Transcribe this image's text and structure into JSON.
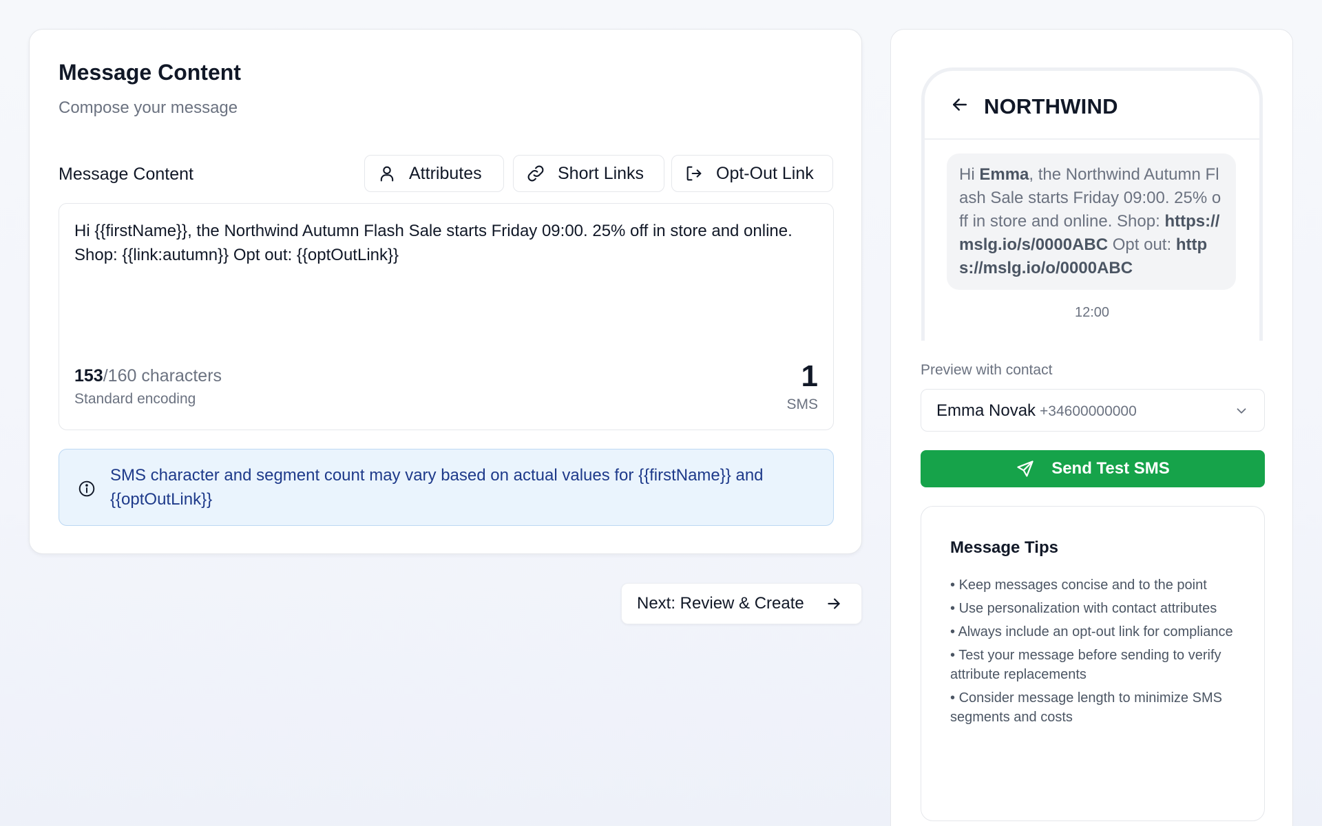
{
  "composer": {
    "title": "Message Content",
    "subtitle": "Compose your message",
    "field_label": "Message Content",
    "toolbar": {
      "attributes_label": "Attributes",
      "short_links_label": "Short Links",
      "opt_out_label": "Opt-Out Link"
    },
    "message_text": "Hi {{firstName}}, the Northwind Autumn Flash Sale starts Friday 09:00. 25% off in store and online. Shop: {{link:autumn}} Opt out: {{optOutLink}}",
    "char_count": "153",
    "char_limit": "/160 characters",
    "encoding": "Standard encoding",
    "sms_count": "1",
    "sms_unit": "SMS",
    "info_text": "SMS character and segment count may vary based on actual values for {{firstName}} and {{optOutLink}}"
  },
  "next_button_label": "Next: Review & Create",
  "preview": {
    "sender": "NORTHWIND",
    "bubble": {
      "part1": "Hi ",
      "name": "Emma",
      "part2": ", the Northwind Autumn Flash Sale starts Friday 09:00. 25% off in store and online. Shop: ",
      "link": "https://mslg.io/s/0000ABC",
      "part3": " Opt out: ",
      "optout_link": "https://mslg.io/o/0000ABC"
    },
    "time": "12:00",
    "contact_label": "Preview with contact",
    "contact_name": "Emma Novak",
    "contact_phone": "+34600000000",
    "send_button_label": "Send Test SMS"
  },
  "tips": {
    "title": "Message Tips",
    "items": [
      "Keep messages concise and to the point",
      "Use personalization with contact attributes",
      "Always include an opt-out link for compliance",
      "Test your message before sending to verify attribute replacements",
      "Consider message length to minimize SMS segments and costs"
    ]
  },
  "colors": {
    "accent_green": "#16a34a",
    "info_bg": "#eaf4fd",
    "info_text": "#1e3a8a"
  },
  "icons": [
    "user-icon",
    "link-icon",
    "opt-out-icon",
    "info-icon",
    "arrow-right-icon",
    "arrow-left-icon",
    "chevron-down-icon",
    "send-icon"
  ]
}
